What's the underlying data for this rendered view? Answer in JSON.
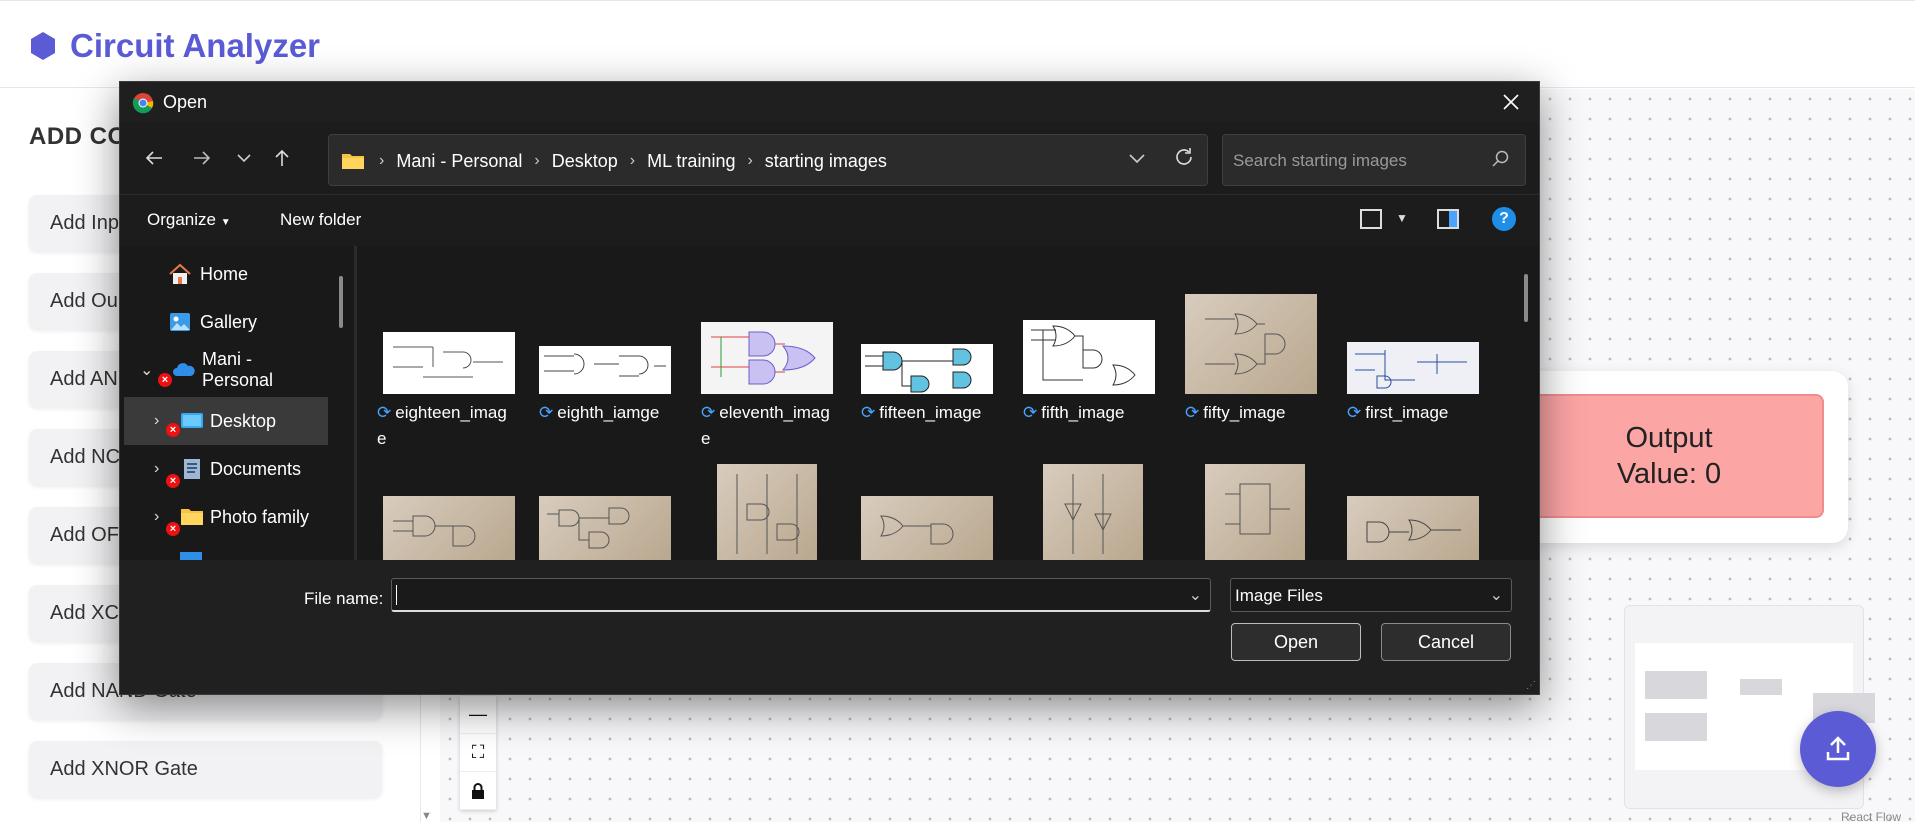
{
  "app": {
    "title": "Circuit Analyzer",
    "brand_color": "#5b5bd6",
    "sidebar": {
      "heading": "ADD CO",
      "buttons": [
        "Add Inp",
        "Add Ou",
        "Add AN",
        "Add NC",
        "Add OF",
        "Add XC",
        "Add NAND Gate",
        "Add XNOR Gate"
      ]
    },
    "output_node": {
      "line1": "Output",
      "line2": "Value: 0",
      "color": "#fca5a5"
    },
    "attribution": "React Flow"
  },
  "dialog": {
    "title": "Open",
    "breadcrumbs": [
      "Mani - Personal",
      "Desktop",
      "ML training",
      "starting images"
    ],
    "search_placeholder": "Search starting images",
    "toolbar": {
      "organize": "Organize",
      "new_folder": "New folder"
    },
    "nav_items": [
      {
        "label": "Home",
        "icon": "home-icon"
      },
      {
        "label": "Gallery",
        "icon": "gallery-icon"
      },
      {
        "label": "Mani - Personal",
        "icon": "onedrive-cloud-icon"
      },
      {
        "label": "Desktop",
        "icon": "desktop-folder-icon"
      },
      {
        "label": "Documents",
        "icon": "documents-folder-icon"
      },
      {
        "label": "Photo family",
        "icon": "folder-icon"
      }
    ],
    "files_row1": [
      "eighteen_imag",
      "eighth_iamge",
      "eleventh_imag",
      "fifteen_image",
      "fifth_image",
      "fifty_image",
      "first_image"
    ],
    "files_row1_wrap": [
      "e",
      "",
      "e",
      "",
      "",
      "",
      ""
    ],
    "file_name_label": "File name:",
    "file_name_value": "",
    "file_type": "Image Files",
    "open_label": "Open",
    "cancel_label": "Cancel"
  }
}
